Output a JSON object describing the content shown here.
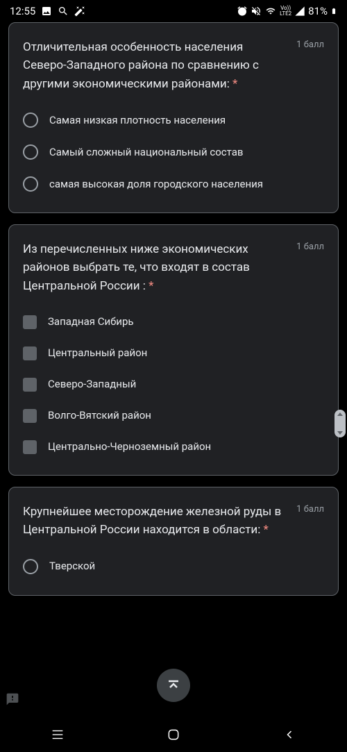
{
  "status": {
    "time": "12:55",
    "battery": "81%",
    "network": "LTE2",
    "volte": "Vo))"
  },
  "questions": [
    {
      "text": "Отличительная особенность населения Северо-Западного района по сравнению с другими экономическими районами: ",
      "points": "1 балл",
      "type": "radio",
      "options": [
        "Самая низкая плотность населения",
        "Самый сложный национальный состав",
        "самая высокая доля городского населения"
      ]
    },
    {
      "text": "Из перечисленных ниже экономических районов выбрать те, что входят в состав Центральной России : ",
      "points": "1 балл",
      "type": "checkbox",
      "options": [
        "Западная Сибирь",
        "Центральный район",
        "Северо-Западный",
        "Волго-Вятский район",
        "Центрально-Черноземный район"
      ]
    },
    {
      "text": "Крупнейшее месторождение железной руды в Центральной России находится в области: ",
      "points": "1 балл",
      "type": "radio",
      "options": [
        "Тверской"
      ]
    }
  ],
  "required_mark": "*"
}
